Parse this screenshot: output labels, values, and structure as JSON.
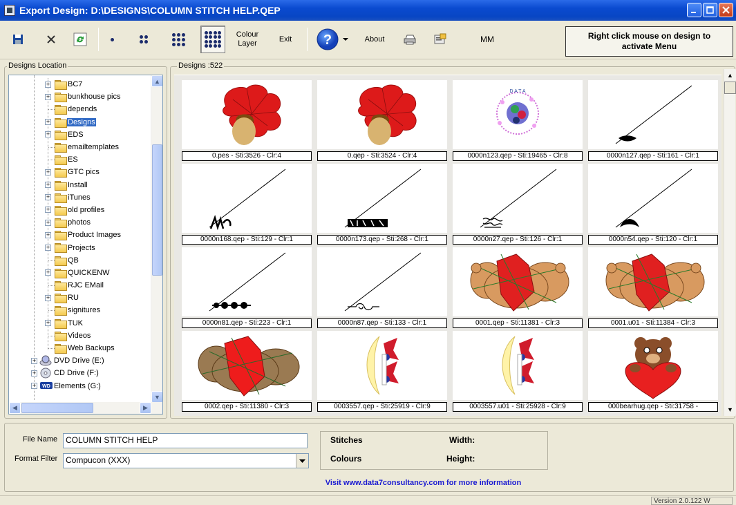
{
  "window": {
    "title": "Export Design: D:\\DESIGNS\\COLUMN STITCH HELP.QEP"
  },
  "toolbar": {
    "colour_layer_line1": "Colour",
    "colour_layer_line2": "Layer",
    "exit_label": "Exit",
    "about_label": "About",
    "mm_label": "MM",
    "hint_text": "Right click mouse on design to activate Menu"
  },
  "locations": {
    "group_label": "Designs Location",
    "items": [
      {
        "label": "BC7",
        "expandable": true
      },
      {
        "label": "bunkhouse pics",
        "expandable": true
      },
      {
        "label": "depends",
        "expandable": false
      },
      {
        "label": "Designs",
        "expandable": true,
        "selected": true
      },
      {
        "label": "EDS",
        "expandable": true
      },
      {
        "label": "emailtemplates",
        "expandable": false
      },
      {
        "label": "ES",
        "expandable": false
      },
      {
        "label": "GTC pics",
        "expandable": true
      },
      {
        "label": "Install",
        "expandable": true
      },
      {
        "label": "iTunes",
        "expandable": true
      },
      {
        "label": "old profiles",
        "expandable": true
      },
      {
        "label": "photos",
        "expandable": true
      },
      {
        "label": "Product Images",
        "expandable": true
      },
      {
        "label": "Projects",
        "expandable": true
      },
      {
        "label": "QB",
        "expandable": false
      },
      {
        "label": "QUICKENW",
        "expandable": true
      },
      {
        "label": "RJC EMail",
        "expandable": false
      },
      {
        "label": "RU",
        "expandable": true
      },
      {
        "label": "signitures",
        "expandable": false
      },
      {
        "label": "TUK",
        "expandable": true
      },
      {
        "label": "Videos",
        "expandable": false
      },
      {
        "label": "Web Backups",
        "expandable": false
      }
    ],
    "drives": [
      {
        "label": "DVD Drive (E:)",
        "icon": "dvd-drive-icon"
      },
      {
        "label": "CD Drive (F:)",
        "icon": "cd-drive-icon"
      },
      {
        "label": "Elements (G:)",
        "icon": "wd-drive-icon"
      }
    ]
  },
  "designs": {
    "group_label": "Designs :522",
    "items": [
      {
        "caption": "0.pes - Sti:3526 - Clr:4",
        "art": "leaf-acorn"
      },
      {
        "caption": "0.qep - Sti:3524 - Clr:4",
        "art": "leaf-acorn"
      },
      {
        "caption": "0000n123.qep - Sti:19465 - Clr:8",
        "art": "wreath"
      },
      {
        "caption": "0000n127.qep - Sti:161 - Clr:1",
        "art": "line-blob"
      },
      {
        "caption": "0000n168.qep - Sti:129 - Clr:1",
        "art": "line-scribble"
      },
      {
        "caption": "0000n173.qep - Sti:268 - Clr:1",
        "art": "line-text"
      },
      {
        "caption": "0000n27.qep - Sti:126 - Clr:1",
        "art": "line-lace"
      },
      {
        "caption": "0000n54.qep - Sti:120 - Clr:1",
        "art": "line-arch"
      },
      {
        "caption": "0000n81.qep - Sti:223 - Clr:1",
        "art": "line-beads"
      },
      {
        "caption": "0000n87.qep - Sti:133 - Clr:1",
        "art": "line-swirl"
      },
      {
        "caption": "0001.qep - Sti:11381 - Clr:3",
        "art": "bear-lying"
      },
      {
        "caption": "0001.u01 - Sti:11384 - Clr:3",
        "art": "bear-lying"
      },
      {
        "caption": "0002.qep - Sti:11380 - Clr:3",
        "art": "bear-lying-dark"
      },
      {
        "caption": "0003557.qep - Sti:25919 - Clr:9",
        "art": "ribbon-moon"
      },
      {
        "caption": "0003557.u01 - Sti:25928 - Clr:9",
        "art": "ribbon-moon"
      },
      {
        "caption": "000bearhug.qep - Sti:31758 -",
        "art": "bear-hug"
      }
    ]
  },
  "bottom": {
    "file_name_label": "File Name",
    "file_name_value": "COLUMN STITCH HELP",
    "format_filter_label": "Format Filter",
    "format_filter_value": "Compucon (XXX)",
    "stitches_label": "Stitches",
    "colours_label": "Colours",
    "width_label": "Width:",
    "height_label": "Height:",
    "visit_text": "Visit www.data7consultancy.com for more information"
  },
  "status": {
    "version": "Version 2.0.122 W"
  }
}
